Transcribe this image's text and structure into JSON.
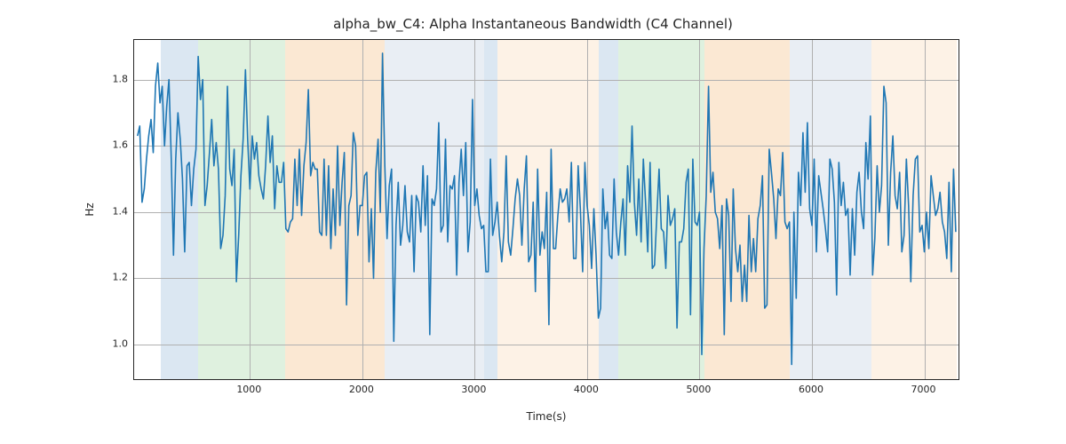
{
  "chart_data": {
    "type": "line",
    "title": "alpha_bw_C4: Alpha Instantaneous Bandwidth (C4 Channel)",
    "xlabel": "Time(s)",
    "ylabel": "Hz",
    "xlim": [
      -30,
      7320
    ],
    "ylim": [
      0.89,
      1.92
    ],
    "x_ticks": [
      1000,
      2000,
      3000,
      4000,
      5000,
      6000,
      7000
    ],
    "y_ticks": [
      1.0,
      1.2,
      1.4,
      1.6,
      1.8
    ],
    "x_tick_labels": [
      "1000",
      "2000",
      "3000",
      "4000",
      "5000",
      "6000",
      "7000"
    ],
    "y_tick_labels": [
      "1.0",
      "1.2",
      "1.4",
      "1.6",
      "1.8"
    ],
    "regions": [
      {
        "x0": 210,
        "x1": 540,
        "color": "#8fb5d6"
      },
      {
        "x0": 540,
        "x1": 1310,
        "color": "#9bd49a"
      },
      {
        "x0": 1310,
        "x1": 2200,
        "color": "#f4b877"
      },
      {
        "x0": 2200,
        "x1": 3080,
        "color": "#bcc9dd"
      },
      {
        "x0": 3080,
        "x1": 3200,
        "color": "#8fb5d6"
      },
      {
        "x0": 3200,
        "x1": 4100,
        "color": "#f8d8b2"
      },
      {
        "x0": 4100,
        "x1": 4280,
        "color": "#8fb5d6"
      },
      {
        "x0": 4280,
        "x1": 5040,
        "color": "#9bd49a"
      },
      {
        "x0": 5040,
        "x1": 5800,
        "color": "#f4b877"
      },
      {
        "x0": 5800,
        "x1": 6530,
        "color": "#bcc9dd"
      },
      {
        "x0": 6530,
        "x1": 7290,
        "color": "#f8d8b2"
      }
    ],
    "line_color": "#1f77b4",
    "series": [
      {
        "name": "alpha_bw_C4",
        "x_start": 0,
        "x_step": 20,
        "values": [
          1.63,
          1.66,
          1.43,
          1.47,
          1.56,
          1.63,
          1.68,
          1.58,
          1.78,
          1.85,
          1.73,
          1.78,
          1.6,
          1.72,
          1.8,
          1.56,
          1.27,
          1.56,
          1.7,
          1.62,
          1.5,
          1.28,
          1.54,
          1.55,
          1.42,
          1.53,
          1.59,
          1.87,
          1.74,
          1.8,
          1.42,
          1.48,
          1.58,
          1.68,
          1.54,
          1.61,
          1.53,
          1.29,
          1.33,
          1.45,
          1.78,
          1.53,
          1.48,
          1.59,
          1.19,
          1.33,
          1.51,
          1.62,
          1.83,
          1.62,
          1.47,
          1.63,
          1.56,
          1.61,
          1.51,
          1.47,
          1.44,
          1.54,
          1.69,
          1.55,
          1.63,
          1.41,
          1.54,
          1.49,
          1.49,
          1.55,
          1.35,
          1.34,
          1.37,
          1.38,
          1.56,
          1.42,
          1.59,
          1.39,
          1.54,
          1.61,
          1.77,
          1.51,
          1.55,
          1.53,
          1.53,
          1.34,
          1.33,
          1.56,
          1.33,
          1.54,
          1.29,
          1.47,
          1.33,
          1.6,
          1.36,
          1.49,
          1.58,
          1.12,
          1.42,
          1.45,
          1.64,
          1.6,
          1.33,
          1.42,
          1.42,
          1.51,
          1.52,
          1.25,
          1.41,
          1.2,
          1.52,
          1.62,
          1.4,
          1.88,
          1.54,
          1.32,
          1.48,
          1.53,
          1.01,
          1.36,
          1.49,
          1.3,
          1.36,
          1.48,
          1.34,
          1.31,
          1.45,
          1.22,
          1.45,
          1.43,
          1.34,
          1.54,
          1.36,
          1.51,
          1.03,
          1.44,
          1.42,
          1.47,
          1.67,
          1.34,
          1.36,
          1.62,
          1.31,
          1.48,
          1.47,
          1.51,
          1.21,
          1.49,
          1.59,
          1.45,
          1.61,
          1.28,
          1.37,
          1.74,
          1.42,
          1.47,
          1.39,
          1.35,
          1.36,
          1.22,
          1.22,
          1.56,
          1.33,
          1.37,
          1.43,
          1.33,
          1.25,
          1.34,
          1.57,
          1.31,
          1.27,
          1.35,
          1.44,
          1.5,
          1.45,
          1.3,
          1.47,
          1.57,
          1.25,
          1.27,
          1.43,
          1.16,
          1.53,
          1.27,
          1.34,
          1.29,
          1.46,
          1.06,
          1.59,
          1.29,
          1.29,
          1.39,
          1.47,
          1.43,
          1.44,
          1.47,
          1.37,
          1.55,
          1.26,
          1.26,
          1.54,
          1.41,
          1.22,
          1.55,
          1.42,
          1.36,
          1.23,
          1.41,
          1.27,
          1.08,
          1.11,
          1.47,
          1.35,
          1.4,
          1.27,
          1.26,
          1.5,
          1.34,
          1.27,
          1.37,
          1.44,
          1.27,
          1.54,
          1.43,
          1.66,
          1.43,
          1.33,
          1.5,
          1.31,
          1.56,
          1.43,
          1.28,
          1.55,
          1.23,
          1.24,
          1.39,
          1.53,
          1.35,
          1.34,
          1.23,
          1.45,
          1.36,
          1.38,
          1.41,
          1.05,
          1.31,
          1.31,
          1.35,
          1.49,
          1.53,
          1.09,
          1.56,
          1.37,
          1.36,
          1.4,
          0.97,
          1.29,
          1.45,
          1.78,
          1.46,
          1.52,
          1.4,
          1.38,
          1.29,
          1.42,
          1.03,
          1.44,
          1.39,
          1.13,
          1.47,
          1.29,
          1.22,
          1.3,
          1.13,
          1.24,
          1.13,
          1.39,
          1.22,
          1.32,
          1.22,
          1.38,
          1.42,
          1.51,
          1.11,
          1.12,
          1.59,
          1.52,
          1.44,
          1.32,
          1.47,
          1.45,
          1.58,
          1.37,
          1.35,
          1.37,
          0.94,
          1.4,
          1.14,
          1.52,
          1.42,
          1.64,
          1.46,
          1.67,
          1.41,
          1.36,
          1.56,
          1.28,
          1.51,
          1.46,
          1.41,
          1.35,
          1.28,
          1.56,
          1.53,
          1.43,
          1.15,
          1.55,
          1.42,
          1.49,
          1.39,
          1.41,
          1.21,
          1.41,
          1.27,
          1.46,
          1.52,
          1.4,
          1.35,
          1.61,
          1.5,
          1.69,
          1.21,
          1.32,
          1.54,
          1.4,
          1.48,
          1.78,
          1.73,
          1.3,
          1.52,
          1.63,
          1.45,
          1.41,
          1.52,
          1.28,
          1.33,
          1.56,
          1.42,
          1.19,
          1.45,
          1.56,
          1.57,
          1.34,
          1.36,
          1.28,
          1.4,
          1.29,
          1.51,
          1.45,
          1.39,
          1.41,
          1.46,
          1.37,
          1.34,
          1.26,
          1.49,
          1.22,
          1.53,
          1.34
        ]
      }
    ]
  }
}
